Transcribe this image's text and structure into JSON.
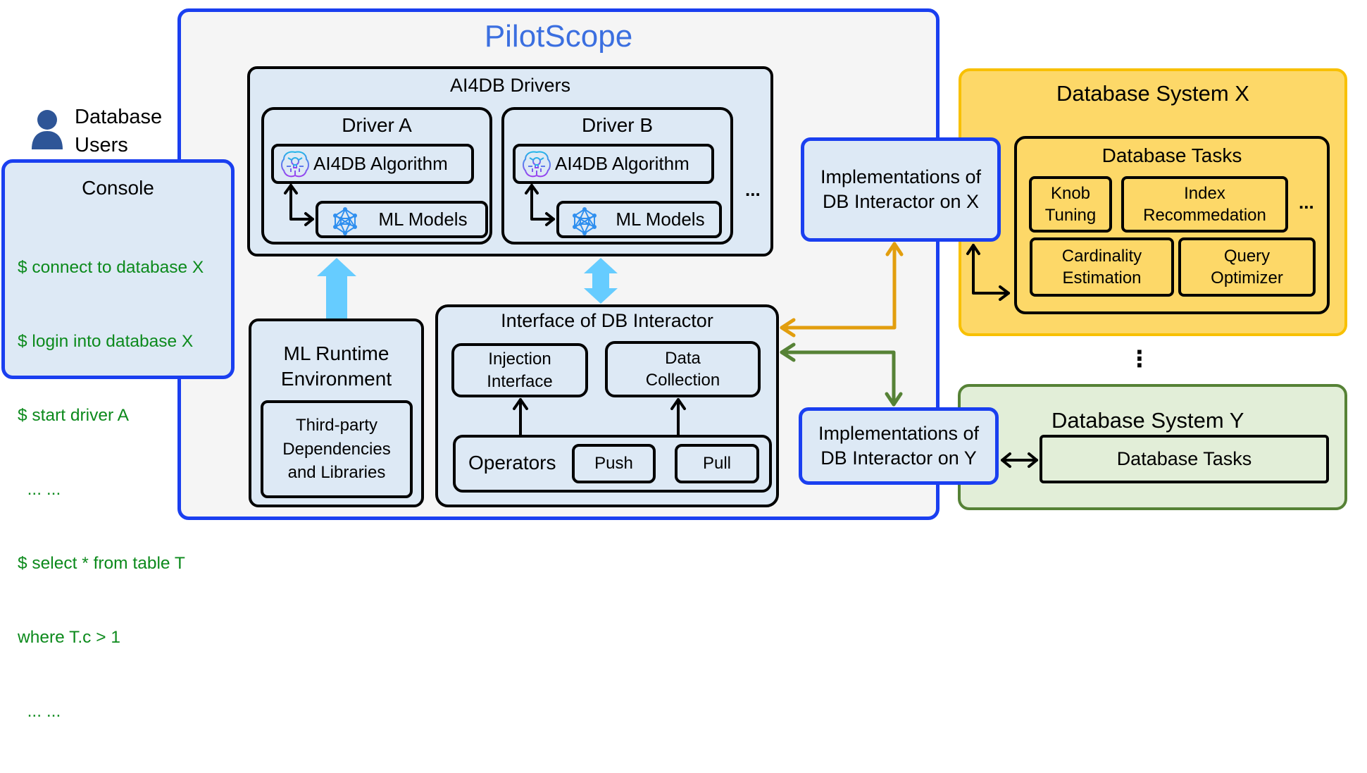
{
  "users": {
    "label_line1": "Database",
    "label_line2": "Users",
    "icon": "user-icon"
  },
  "console": {
    "title": "Console",
    "lines": [
      "$ connect to database X",
      "$ login into database X",
      "$ start driver A",
      "  ... ...",
      "$ select * from table T",
      "where T.c > 1",
      "  ... ..."
    ]
  },
  "pilotscope": {
    "title": "PilotScope",
    "drivers": {
      "title": "AI4DB Drivers",
      "items": [
        {
          "title": "Driver A",
          "algorithm": "AI4DB Algorithm",
          "models": "ML Models"
        },
        {
          "title": "Driver B",
          "algorithm": "AI4DB Algorithm",
          "models": "ML Models"
        }
      ],
      "more": "..."
    },
    "runtime": {
      "title_line1": "ML Runtime",
      "title_line2": "Environment",
      "deps_line1": "Third-party",
      "deps_line2": "Dependencies",
      "deps_line3": "and Libraries"
    },
    "interface": {
      "title": "Interface of DB Interactor",
      "injection_line1": "Injection",
      "injection_line2": "Interface",
      "collection_line1": "Data",
      "collection_line2": "Collection",
      "operators": "Operators",
      "push": "Push",
      "pull": "Pull"
    },
    "impl_x": {
      "line1": "Implementations of",
      "line2": "DB Interactor on X"
    },
    "impl_y": {
      "line1": "Implementations of",
      "line2": "DB Interactor on Y"
    }
  },
  "system_x": {
    "title": "Database System X",
    "tasks_title": "Database Tasks",
    "tasks": [
      {
        "line1": "Knob",
        "line2": "Tuning"
      },
      {
        "line1": "Index",
        "line2": "Recommedation"
      },
      {
        "line1": "Cardinality",
        "line2": "Estimation"
      },
      {
        "line1": "Query",
        "line2": "Optimizer"
      }
    ],
    "more": "..."
  },
  "vertical_ellipsis": "⋮",
  "system_y": {
    "title": "Database System Y",
    "tasks_title": "Database Tasks"
  },
  "colors": {
    "pilotscope_border": "#1a3ff0",
    "pilotscope_title": "#3b6fe0",
    "console_text": "#0c8a1c",
    "system_x_fill": "#fdd868",
    "system_x_border": "#f8c000",
    "system_y_fill": "#e2eed8",
    "system_y_border": "#568236",
    "arrow_orange": "#e29e0e",
    "arrow_green": "#568236",
    "arrow_lightblue": "#66ccff"
  }
}
